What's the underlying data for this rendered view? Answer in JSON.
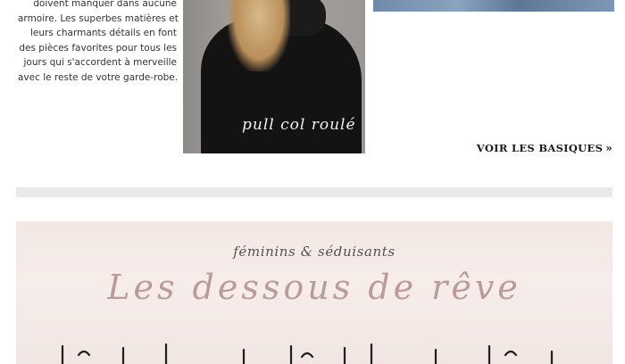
{
  "intro": {
    "lines": [
      "doivent manquer dans aucune",
      "armoire. Les superbes matières et",
      "leurs charmants détails en font",
      "des pièces favorites pour tous les",
      "jours qui s'accordent à merveille",
      "avec le reste de votre garde-robe."
    ]
  },
  "sweater_photo": {
    "caption": "pull col roulé"
  },
  "cta": {
    "label": "VOIR LES BASIQUES",
    "arrows": "»"
  },
  "lingerie": {
    "kicker": "féminins & séduisants",
    "headline": "Les dessous de rêve"
  }
}
